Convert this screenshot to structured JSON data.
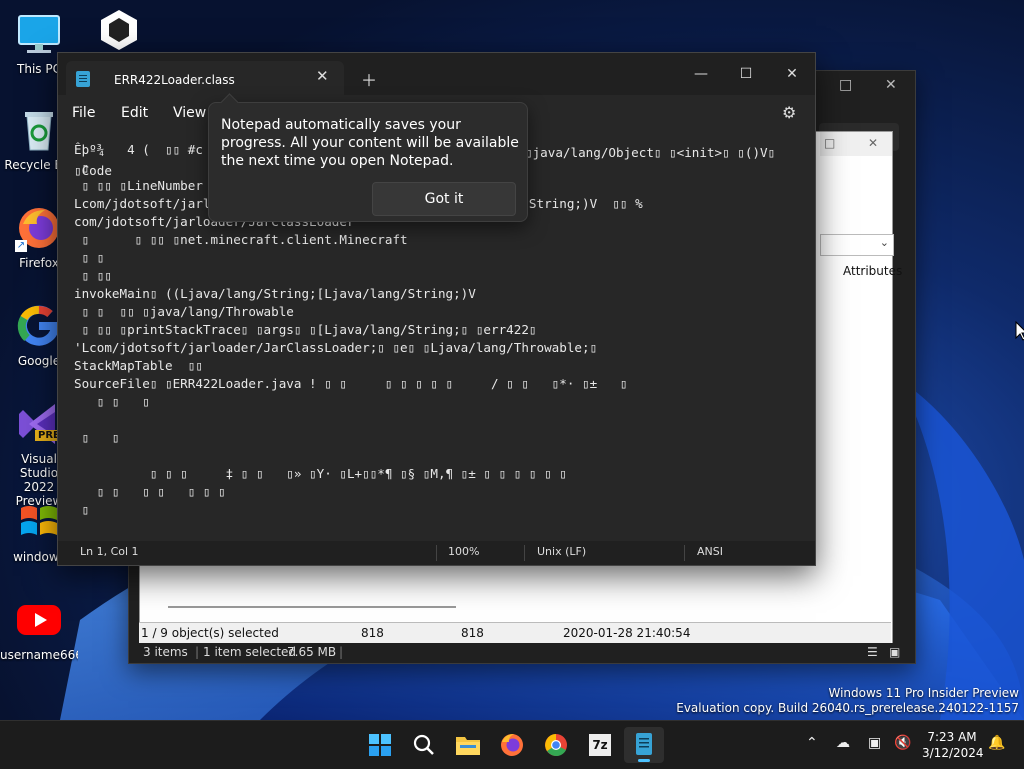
{
  "desktop": {
    "icons": [
      {
        "label": "This PC",
        "icon": "computer-icon"
      },
      {
        "label": "Unity",
        "icon": "unity-icon"
      },
      {
        "label": "Recycle Bin",
        "icon": "recycle-bin-icon"
      },
      {
        "label": "Firefox",
        "icon": "firefox-icon"
      },
      {
        "label": "Google",
        "icon": "chrome-icon"
      },
      {
        "label": "Visual Studio 2022 Preview",
        "icon": "visual-studio-icon",
        "badge": "PRE"
      },
      {
        "label": "windows",
        "icon": "windows-logo-icon"
      },
      {
        "label": "username666",
        "icon": "youtube-icon"
      }
    ]
  },
  "sevenzip": {
    "column_attributes": "Attributes",
    "status": {
      "selected": "1 / 9 object(s) selected",
      "size": "818",
      "packed": "818",
      "modified": "2020-01-28 21:40:54"
    },
    "footer": {
      "items": "3 items",
      "selected": "1 item selected",
      "size": "7.65 MB"
    }
  },
  "notepad": {
    "tab_title": "ERR422Loader.class",
    "menu": [
      "File",
      "Edit",
      "View"
    ],
    "content_lines": [
      "Êþº¾   4 (  ▯▯ #c",
      " ▯",
      " ▯ ▯▯ ▯LineNumber",
      "Lcom/jdotsoft/jarloader/ERR422Loader;▯ ▯main▯ ▯([Ljava/lang/String;)V  ▯▯ %",
      "com/jdotsoft/jarloader/JarClassLoader",
      " ▯      ▯ ▯▯ ▯net.minecraft.client.Minecraft",
      " ▯ ▯",
      " ▯ ▯▯",
      "invokeMain▯ ((Ljava/lang/String;[Ljava/lang/String;)V",
      " ▯ ▯  ▯▯ ▯java/lang/Throwable",
      " ▯ ▯▯ ▯printStackTrace▯ ▯args▯ ▯[Ljava/lang/String;▯ ▯err422▯",
      "'Lcom/jdotsoft/jarloader/JarClassLoader;▯ ▯e▯ ▯Ljava/lang/Throwable;▯",
      "StackMapTable  ▯▯",
      "SourceFile▯ ▯ERR422Loader.java ! ▯ ▯     ▯ ▯ ▯ ▯ ▯     / ▯ ▯   ▯*· ▯±   ▯",
      "   ▯ ▯   ▯",
      "",
      " ▯   ▯",
      "",
      "          ▯ ▯ ▯     ‡ ▯ ▯   ▯» ▯Y· ▯L+▯▯*¶ ▯§ ▯M,¶ ▯± ▯ ▯ ▯ ▯ ▯ ▯",
      "   ▯ ▯   ▯ ▯   ▯ ▯ ▯",
      " ▯"
    ],
    "tail_line1": "▯java/lang/Object▯ ▯<init>▯ ▯()V▯",
    "tail_line2": "▯Code",
    "tip": {
      "text": "Notepad automatically saves your progress. All your content will be available the next time you open Notepad.",
      "button": "Got it"
    },
    "status": {
      "position": "Ln 1, Col 1",
      "zoom": "100%",
      "line_ending": "Unix (LF)",
      "encoding": "ANSI"
    }
  },
  "watermark": {
    "line1": "Windows 11 Pro Insider Preview",
    "line2": "Evaluation copy. Build 26040.rs_prerelease.240122-1157"
  },
  "taskbar": {
    "apps": [
      "start-icon",
      "search-icon",
      "file-explorer-icon",
      "firefox-icon",
      "chrome-icon",
      "7zip-icon",
      "notepad-icon"
    ],
    "sevenzip_label": "7z",
    "time": "7:23 AM",
    "date": "3/12/2024"
  }
}
